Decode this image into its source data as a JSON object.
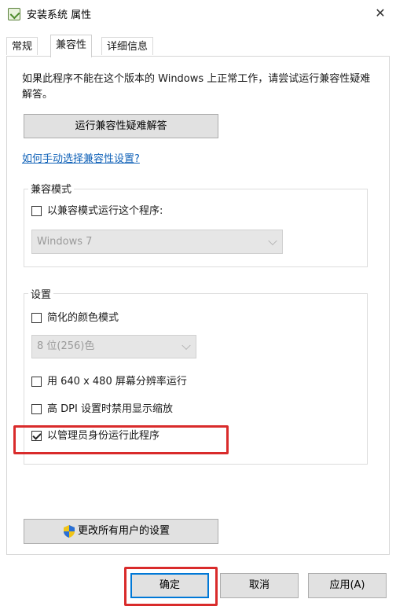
{
  "window": {
    "title": "安装系统 属性",
    "close_glyph": "✕",
    "app_icon": "checkbox-app-icon"
  },
  "tabs": [
    {
      "label": "常规",
      "active": false
    },
    {
      "label": "兼容性",
      "active": true
    },
    {
      "label": "详细信息",
      "active": false
    }
  ],
  "compat": {
    "description": "如果此程序不能在这个版本的 Windows 上正常工作，请尝试运行兼容性疑难解答。",
    "troubleshoot_button": "运行兼容性疑难解答",
    "manual_link": "如何手动选择兼容性设置?"
  },
  "compat_mode": {
    "group_label": "兼容模式",
    "checkbox_label": "以兼容模式运行这个程序:",
    "checked": false,
    "os_select_value": "Windows 7"
  },
  "settings": {
    "group_label": "设置",
    "reduced_color_label": "简化的颜色模式",
    "reduced_color_checked": false,
    "color_select_value": "8 位(256)色",
    "resolution_label": "用 640 x 480 屏幕分辨率运行",
    "resolution_checked": false,
    "dpi_label": "高 DPI 设置时禁用显示缩放",
    "dpi_checked": false,
    "admin_label": "以管理员身份运行此程序",
    "admin_checked": true
  },
  "all_users_button": "更改所有用户的设置",
  "footer": {
    "ok": "确定",
    "cancel": "取消",
    "apply": "应用(A)"
  },
  "colors": {
    "highlight": "#d92b2b",
    "link": "#1062b8",
    "focus": "#0078d7"
  }
}
